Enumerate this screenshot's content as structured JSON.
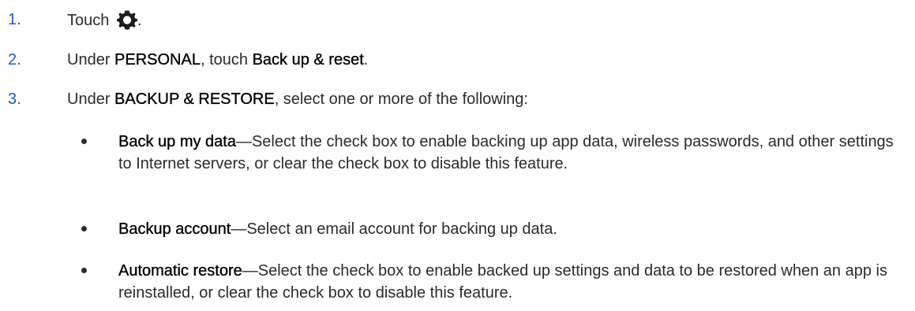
{
  "steps": [
    {
      "number": "1.",
      "prefix": "Touch ",
      "icon": "gear-icon",
      "suffix": "."
    },
    {
      "number": "2.",
      "text_a": "Under ",
      "bold_a": "PERSONAL",
      "text_b": ", touch ",
      "bold_b": "Back up & reset",
      "text_c": "."
    },
    {
      "number": "3.",
      "text_a": "Under ",
      "bold_a": "BACKUP & RESTORE",
      "text_b": ", select one or more of the following:"
    }
  ],
  "bullets": [
    {
      "term": "Back up my data",
      "desc": "—Select the check box to enable backing up app data, wireless passwords, and other settings to Internet servers, or clear the check box to disable this feature."
    },
    {
      "term": "Backup account",
      "desc": "—Select an email account for backing up data."
    },
    {
      "term": "Automatic restore",
      "desc": "—Select the check box to enable backed up settings and data to be restored when an app is reinstalled, or clear the check box to disable this feature."
    }
  ],
  "colors": {
    "step_number": "#1a5fd0",
    "text": "#2b2b2b"
  }
}
